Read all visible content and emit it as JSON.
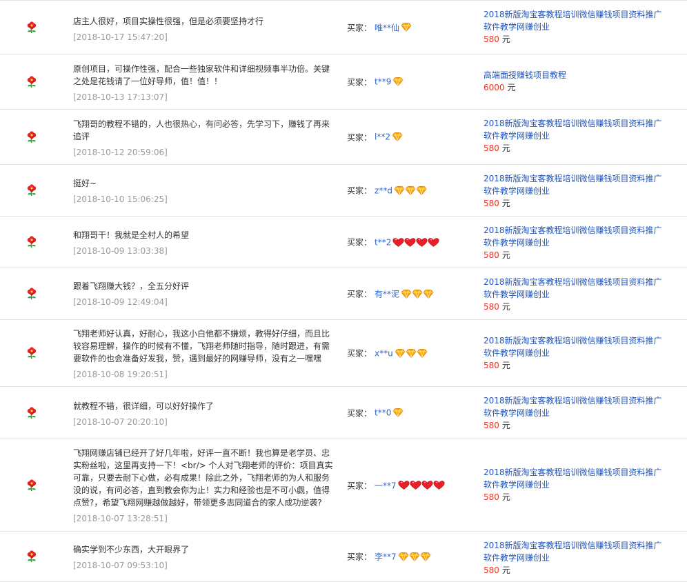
{
  "labels": {
    "buyer": "买家：",
    "currency": "元"
  },
  "colors": {
    "gold": "#ffaa00",
    "red_heart": "#e8202a"
  },
  "icons": {
    "row": "flower-icon",
    "diamond": "diamond-icon",
    "heart": "heart-icon"
  },
  "reviews": [
    {
      "text": "店主人很好，项目实操性很强，但是必须要坚持才行",
      "date": "[2018-10-17 15:47:20]",
      "buyer": "唯**仙",
      "rank_type": "diamond",
      "rank_count": 1,
      "product": "2018新版淘宝客教程培训微信赚钱项目资料推广软件教学网赚创业",
      "price": "580"
    },
    {
      "text": "原创项目，可操作性强，配合一些独家软件和详细视频事半功倍。关键之处是花钱请了一位好导师，值！值！！",
      "date": "[2018-10-13 17:13:07]",
      "buyer": "t**9",
      "rank_type": "diamond",
      "rank_count": 1,
      "product": "高端面授赚钱项目教程",
      "price": "6000"
    },
    {
      "text": "飞翔哥的教程不错的，人也很热心，有问必答，先学习下，赚钱了再来追评",
      "date": "[2018-10-12 20:59:06]",
      "buyer": "l**2",
      "rank_type": "diamond",
      "rank_count": 1,
      "product": "2018新版淘宝客教程培训微信赚钱项目资料推广软件教学网赚创业",
      "price": "580"
    },
    {
      "text": "挺好~",
      "date": "[2018-10-10 15:06:25]",
      "buyer": "z**d",
      "rank_type": "diamond",
      "rank_count": 3,
      "product": "2018新版淘宝客教程培训微信赚钱项目资料推广软件教学网赚创业",
      "price": "580"
    },
    {
      "text": "和翔哥干！我就是全村人的希望",
      "date": "[2018-10-09 13:03:38]",
      "buyer": "t**2",
      "rank_type": "heart",
      "rank_count": 4,
      "product": "2018新版淘宝客教程培训微信赚钱项目资料推广软件教学网赚创业",
      "price": "580"
    },
    {
      "text": "跟着飞翔赚大钱？，全五分好评",
      "date": "[2018-10-09 12:49:04]",
      "buyer": "有**泥",
      "rank_type": "diamond",
      "rank_count": 3,
      "product": "2018新版淘宝客教程培训微信赚钱项目资料推广软件教学网赚创业",
      "price": "580"
    },
    {
      "text": "飞翔老师好认真，好耐心，我这小白他都不嫌烦，教得好仔细，而且比较容易理解，操作的时候有不懂，飞翔老师随时指导，随时跟进，有需要软件的也会准备好发我，赞，遇到最好的网赚导师，没有之一嘿嘿",
      "date": "[2018-10-08 19:20:51]",
      "buyer": "x**u",
      "rank_type": "diamond",
      "rank_count": 3,
      "product": "2018新版淘宝客教程培训微信赚钱项目资料推广软件教学网赚创业",
      "price": "580"
    },
    {
      "text": "就教程不错，很详细，可以好好操作了",
      "date": "[2018-10-07 20:20:10]",
      "buyer": "t**0",
      "rank_type": "diamond",
      "rank_count": 1,
      "product": "2018新版淘宝客教程培训微信赚钱项目资料推广软件教学网赚创业",
      "price": "580"
    },
    {
      "text": "飞翔网赚店铺已经开了好几年啦，好评一直不断！我也算是老学员、忠实粉丝啦，这里再支持一下！<br/> 个人对飞翔老师的评价：项目真实可靠，只要去耐下心做，必有成果！除此之外，飞翔老师的为人和服务没的说，有问必答，直到教会你为止！实力和经验也是不可小觑，值得点赞?，希望飞翔网赚越做越好，带领更多志同道合的家人成功逆袭?",
      "date": "[2018-10-07 13:28:51]",
      "buyer": "一**7",
      "rank_type": "heart",
      "rank_count": 4,
      "product": "2018新版淘宝客教程培训微信赚钱项目资料推广软件教学网赚创业",
      "price": "580"
    },
    {
      "text": "确实学到不少东西，大开眼界了",
      "date": "[2018-10-07 09:53:10]",
      "buyer": "李**7",
      "rank_type": "diamond",
      "rank_count": 3,
      "product": "2018新版淘宝客教程培训微信赚钱项目资料推广软件教学网赚创业",
      "price": "580"
    }
  ]
}
